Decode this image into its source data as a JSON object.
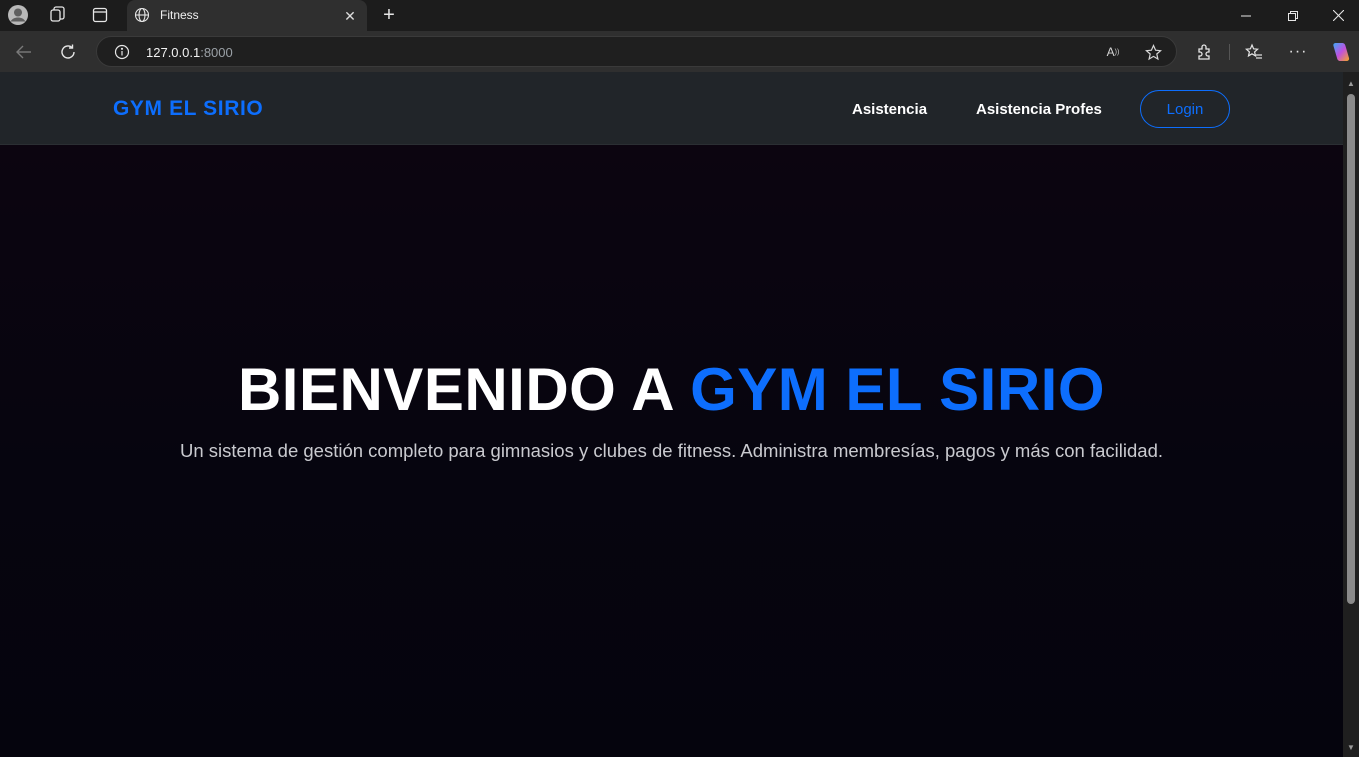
{
  "browser": {
    "tab": {
      "title": "Fitness"
    },
    "address": {
      "host": "127.0.0.1",
      "port": ":8000"
    }
  },
  "site": {
    "brand": "GYM EL SIRIO",
    "nav": {
      "links": [
        "Asistencia",
        "Asistencia Profes"
      ],
      "login": "Login"
    },
    "hero": {
      "title_prefix": "BIENVENIDO A ",
      "title_accent": "GYM EL SIRIO",
      "subtitle": "Un sistema de gestión completo para gimnasios y clubes de fitness. Administra membresías, pagos y más con facilidad."
    }
  },
  "colors": {
    "accent": "#0d6efd",
    "navbar": "#212529",
    "background": "#06050f",
    "text": "#ffffff"
  }
}
